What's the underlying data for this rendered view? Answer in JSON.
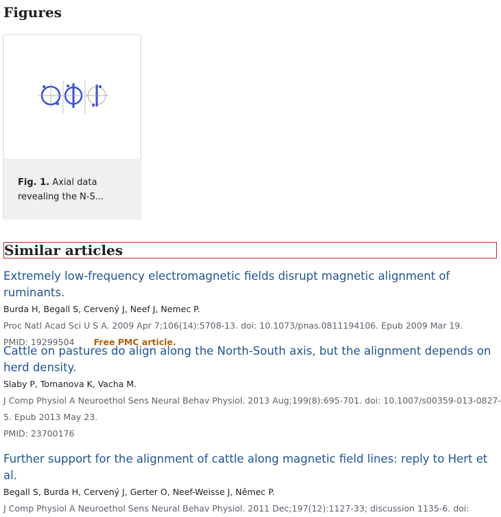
{
  "figures": {
    "heading": "Figures",
    "items": [
      {
        "label": "Fig. 1.",
        "caption": "Axial data revealing the N-S..."
      }
    ]
  },
  "similar_articles": {
    "heading": "Similar articles",
    "items": [
      {
        "title": "Extremely low-frequency electromagnetic fields disrupt magnetic alignment of ruminants.",
        "authors": "Burda H, Begall S, Cervený J, Neef J, Nemec P.",
        "citation": "Proc Natl Acad Sci U S A. 2009 Apr 7;106(14):5708-13. doi: 10.1073/pnas.0811194106. Epub 2009 Mar 19.",
        "pmid": "PMID: 19299504",
        "free_pmc": "Free PMC article."
      },
      {
        "title": "Cattle on pastures do align along the North-South axis, but the alignment depends on herd density.",
        "authors": "Slaby P, Tomanova K, Vacha M.",
        "citation": "J Comp Physiol A Neuroethol Sens Neural Behav Physiol. 2013 Aug;199(8):695-701. doi: 10.1007/s00359-013-0827-5. Epub 2013 May 23.",
        "pmid": "PMID: 23700176"
      },
      {
        "title": "Further support for the alignment of cattle along magnetic field lines: reply to Hert et al.",
        "authors": "Begall S, Burda H, Cervený J, Gerter O, Neef-Weisse J, Němec P.",
        "citation": "J Comp Physiol A Neuroethol Sens Neural Behav Physiol. 2011 Dec;197(12):1127-33; discussion 1135-6. doi:"
      }
    ]
  }
}
